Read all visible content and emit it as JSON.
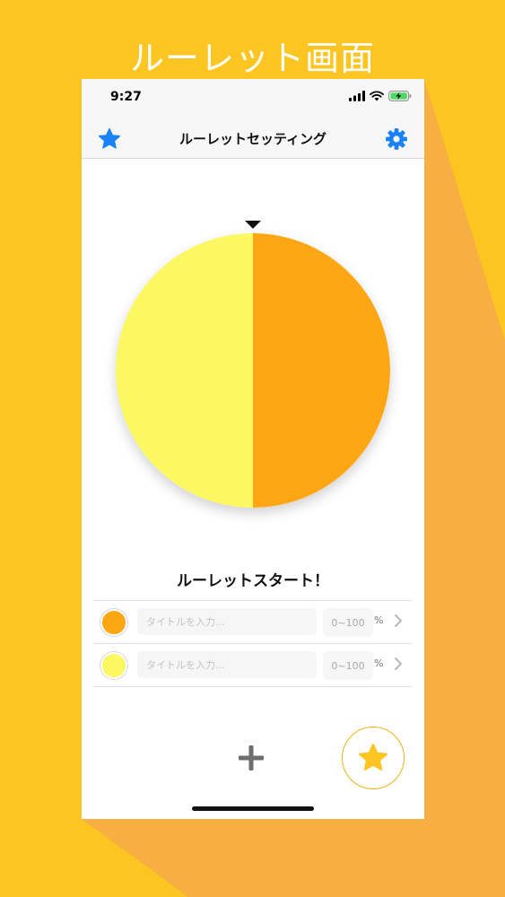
{
  "promo": {
    "title": "ルーレット画面"
  },
  "colors": {
    "background": "#fcc522",
    "shadow": "#f7ae43",
    "slice_orange": "#ffa614",
    "slice_yellow": "#fcf862",
    "accent_blue": "#1a82f7",
    "fav_star": "#fcc522"
  },
  "status_bar": {
    "time": "9:27",
    "icons": [
      "signal-icon",
      "wifi-icon",
      "battery-charging-icon"
    ]
  },
  "navbar": {
    "title": "ルーレットセッティング",
    "left_icon": "star-icon",
    "right_icon": "gear-icon"
  },
  "roulette": {
    "slices": [
      {
        "color": "#ffa614",
        "fraction": 0.5
      },
      {
        "color": "#fcf862",
        "fraction": 0.5
      }
    ],
    "start_label": "ルーレットスタート！"
  },
  "entries": [
    {
      "color": "#ffa614",
      "title_placeholder": "タイトルを入力...",
      "title_value": "",
      "percent_placeholder": "0~100",
      "percent_value": "",
      "percent_unit": "%"
    },
    {
      "color": "#fcf862",
      "title_placeholder": "タイトルを入力...",
      "title_value": "",
      "percent_placeholder": "0~100",
      "percent_value": "",
      "percent_unit": "%"
    }
  ],
  "bottom": {
    "add_icon": "plus-icon",
    "fav_icon": "star-icon"
  }
}
